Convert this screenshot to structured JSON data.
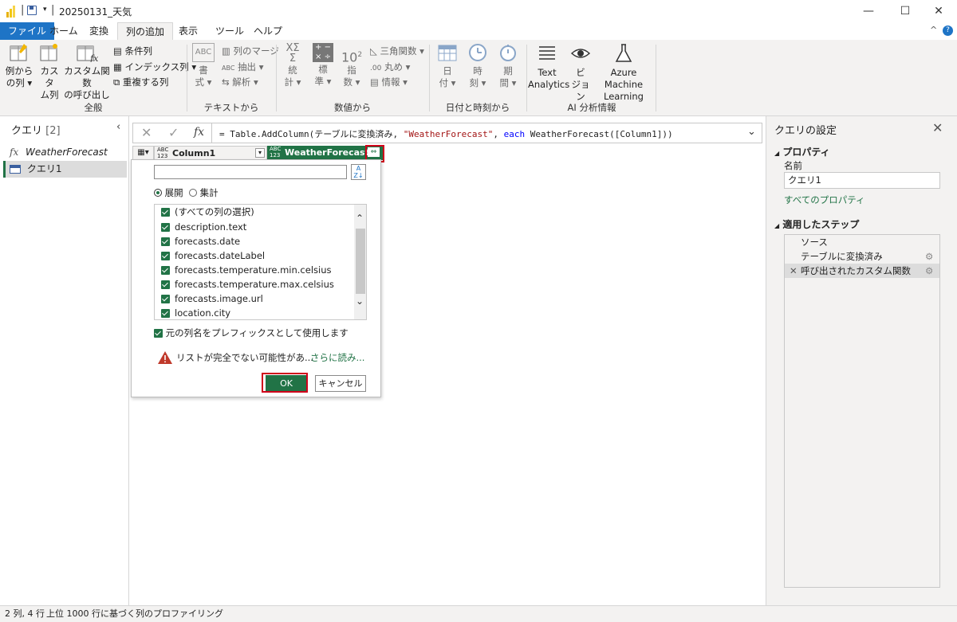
{
  "window": {
    "title": "20250131_天気",
    "minimize": "—",
    "maximize": "☐",
    "close": "✕"
  },
  "tabs": [
    "ファイル",
    "ホーム",
    "変換",
    "列の追加",
    "表示",
    "ツール",
    "ヘルプ"
  ],
  "ribbon": {
    "general": {
      "label": "全般",
      "col_from_example_1": "例から",
      "col_from_example_2": "の列",
      "custom_col_1": "カスタ",
      "custom_col_2": "ム列",
      "invoke_fn_1": "カスタム関数",
      "invoke_fn_2": "の呼び出し",
      "conditional": "条件列",
      "index": "インデックス列",
      "duplicate": "重複する列"
    },
    "text": {
      "label": "テキストから",
      "format_1": "書",
      "format_2": "式",
      "merge": "列のマージ",
      "extract": "抽出",
      "parse": "解析"
    },
    "number": {
      "label": "数値から",
      "stats_1": "統",
      "stats_2": "計",
      "std_1": "標",
      "std_2": "準",
      "sci_1": "指",
      "sci_2": "数",
      "trig": "三角関数",
      "round": "丸め",
      "info": "情報"
    },
    "datetime": {
      "label": "日付と時刻から",
      "date_1": "日",
      "date_2": "付",
      "time_1": "時",
      "time_2": "刻",
      "duration_1": "期",
      "duration_2": "間"
    },
    "ai": {
      "label": "AI 分析情報",
      "text_1": "Text",
      "text_2": "Analytics",
      "vision_1": "ビ",
      "vision_2": "ジョン",
      "aml_1": "Azure Machine",
      "aml_2": "Learning"
    }
  },
  "left_pane": {
    "title": "クエリ",
    "count": "[2]",
    "items": [
      {
        "label": "WeatherForecast",
        "icon": "fx-icon"
      },
      {
        "label": "クエリ1",
        "icon": "table-icon"
      }
    ]
  },
  "formula": {
    "prefix": "= Table.AddColumn(テーブルに変換済み, ",
    "string": "\"WeatherForecast\"",
    "mid": ", ",
    "keyword": "each",
    "suffix": " WeatherForecast([Column1]))"
  },
  "columns": [
    {
      "type": "ABC\n123",
      "name": "Column1"
    },
    {
      "type": "ABC\n123",
      "name": "WeatherForecast"
    }
  ],
  "expand_dialog": {
    "search_value": "",
    "radio_expand": "展開",
    "radio_aggregate": "集計",
    "items": [
      "(すべての列の選択)",
      "description.text",
      "forecasts.date",
      "forecasts.dateLabel",
      "forecasts.temperature.min.celsius",
      "forecasts.temperature.max.celsius",
      "forecasts.image.url",
      "location.city"
    ],
    "prefix_label": "元の列名をプレフィックスとして使用します",
    "warning": "リストが完全でない可能性があ...",
    "more": "さらに読み...",
    "ok": "OK",
    "cancel": "キャンセル"
  },
  "right_pane": {
    "title": "クエリの設定",
    "properties": "プロパティ",
    "name_label": "名前",
    "name_value": "クエリ1",
    "all_props": "すべてのプロパティ",
    "steps_title": "適用したステップ",
    "steps": [
      "ソース",
      "テーブルに変換済み",
      "呼び出されたカスタム関数"
    ]
  },
  "status": {
    "left": "2 列, 4 行",
    "right": "上位 1000 行に基づく列のプロファイリング"
  },
  "colors": {
    "accent": "#217346",
    "file_tab": "#1e74c6",
    "highlight": "#d0021b"
  }
}
